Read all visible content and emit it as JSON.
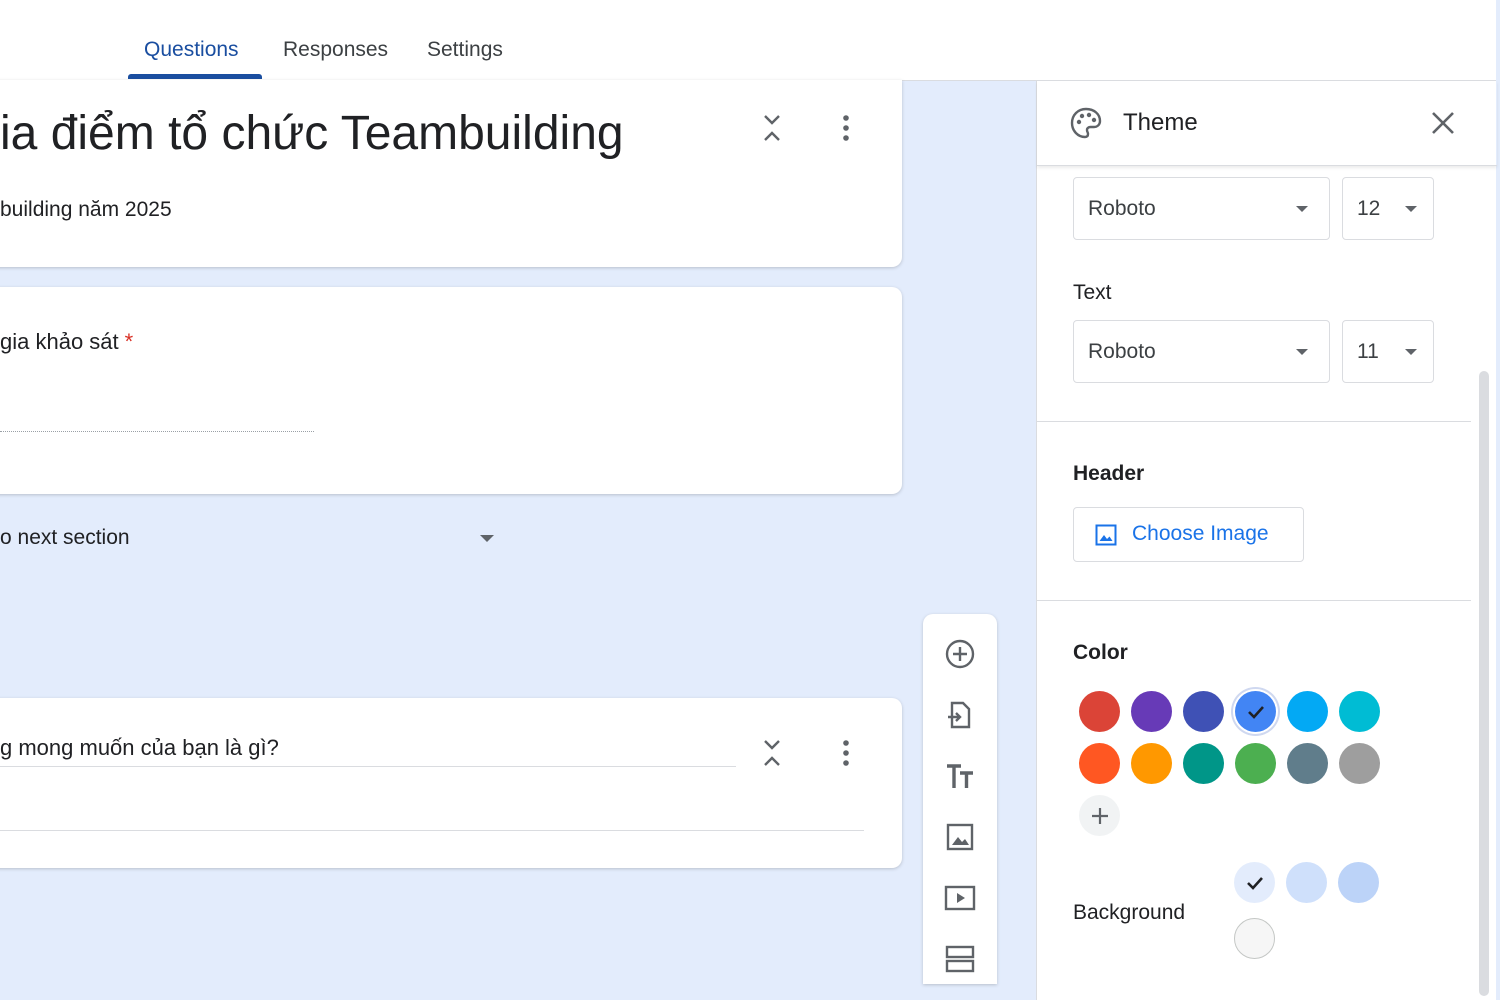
{
  "tabs": [
    {
      "label": "Questions",
      "active": true
    },
    {
      "label": "Responses",
      "active": false
    },
    {
      "label": "Settings",
      "active": false
    }
  ],
  "form": {
    "title": "ia điểm tổ chức Teambuilding",
    "description": "building năm 2025",
    "question1": {
      "text": "gia khảo sát",
      "required_mark": "*"
    },
    "after_section": "o next section",
    "question2": {
      "text": "g mong muốn của bạn là gì?"
    }
  },
  "theme_panel": {
    "title": "Theme",
    "header_font": {
      "family": "Roboto",
      "size": "12"
    },
    "text_label": "Text",
    "text_font": {
      "family": "Roboto",
      "size": "11"
    },
    "header_label": "Header",
    "choose_image_label": "Choose Image",
    "color_label": "Color",
    "colors": [
      "#db4437",
      "#673ab7",
      "#3f51b5",
      "#4285f4",
      "#03a9f4",
      "#00bcd4",
      "#ff5722",
      "#ff9800",
      "#009688",
      "#4caf50",
      "#607d8b",
      "#9e9e9e"
    ],
    "selected_color": "#4285f4",
    "background_label": "Background",
    "background_colors": [
      "#e3ecfc",
      "#cfe0fb",
      "#bcd3f8",
      "#f6f6f6"
    ],
    "selected_background": "#e3ecfc"
  },
  "icons": {
    "collapse": "collapse-icon",
    "more": "more-vert-icon",
    "palette": "palette-icon",
    "close": "close-icon",
    "add_question": "add-circle-icon",
    "import": "import-icon",
    "title_text": "title-text-icon",
    "image": "image-icon",
    "video": "video-icon",
    "section": "section-icon"
  }
}
